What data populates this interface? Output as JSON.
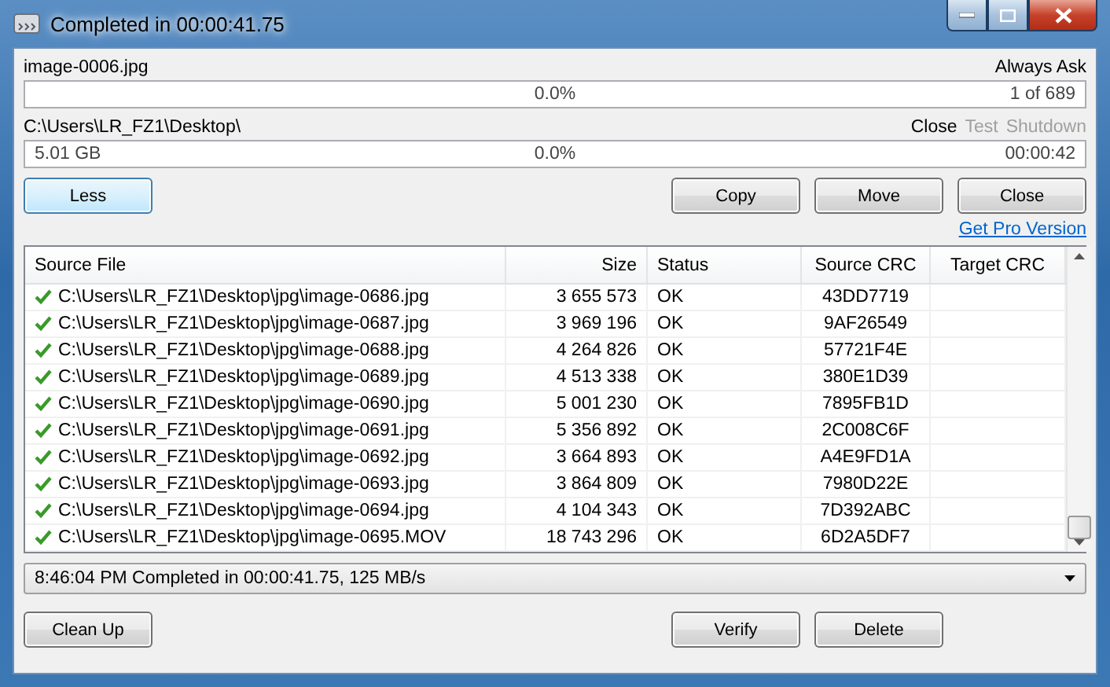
{
  "window": {
    "title": "Completed in 00:00:41.75"
  },
  "file_progress": {
    "name": "image-0006.jpg",
    "mode": "Always Ask",
    "level": 0,
    "percent": "0.0%",
    "count": "1 of 689"
  },
  "total_progress": {
    "path": "C:\\Users\\LR_FZ1\\Desktop\\",
    "size": "5.01 GB",
    "level": 0,
    "percent": "0.0%",
    "time": "00:00:42"
  },
  "after_actions": [
    {
      "label": "Close",
      "disabled": false
    },
    {
      "label": "Test",
      "disabled": true
    },
    {
      "label": "Shutdown",
      "disabled": true
    }
  ],
  "top_buttons": {
    "left": {
      "label": "Less",
      "focused": true
    },
    "right": [
      {
        "label": "Copy"
      },
      {
        "label": "Move"
      },
      {
        "label": "Close"
      }
    ]
  },
  "pro_link": "Get Pro Version",
  "table": {
    "columns": [
      "Source File",
      "Size",
      "Status",
      "Source CRC",
      "Target CRC"
    ],
    "rows": [
      {
        "file": "C:\\Users\\LR_FZ1\\Desktop\\jpg\\image-0686.jpg",
        "size": "3 655 573",
        "status": "OK",
        "source_crc": "43DD7719",
        "ok": true
      },
      {
        "file": "C:\\Users\\LR_FZ1\\Desktop\\jpg\\image-0687.jpg",
        "size": "3 969 196",
        "status": "OK",
        "source_crc": "9AF26549",
        "ok": true
      },
      {
        "file": "C:\\Users\\LR_FZ1\\Desktop\\jpg\\image-0688.jpg",
        "size": "4 264 826",
        "status": "OK",
        "source_crc": "57721F4E",
        "ok": true
      },
      {
        "file": "C:\\Users\\LR_FZ1\\Desktop\\jpg\\image-0689.jpg",
        "size": "4 513 338",
        "status": "OK",
        "source_crc": "380E1D39",
        "ok": true
      },
      {
        "file": "C:\\Users\\LR_FZ1\\Desktop\\jpg\\image-0690.jpg",
        "size": "5 001 230",
        "status": "OK",
        "source_crc": "7895FB1D",
        "ok": true
      },
      {
        "file": "C:\\Users\\LR_FZ1\\Desktop\\jpg\\image-0691.jpg",
        "size": "5 356 892",
        "status": "OK",
        "source_crc": "2C008C6F",
        "ok": true
      },
      {
        "file": "C:\\Users\\LR_FZ1\\Desktop\\jpg\\image-0692.jpg",
        "size": "3 664 893",
        "status": "OK",
        "source_crc": "A4E9FD1A",
        "ok": true
      },
      {
        "file": "C:\\Users\\LR_FZ1\\Desktop\\jpg\\image-0693.jpg",
        "size": "3 864 809",
        "status": "OK",
        "source_crc": "7980D22E",
        "ok": true
      },
      {
        "file": "C:\\Users\\LR_FZ1\\Desktop\\jpg\\image-0694.jpg",
        "size": "4 104 343",
        "status": "OK",
        "source_crc": "7D392ABC",
        "ok": true
      },
      {
        "file": "C:\\Users\\LR_FZ1\\Desktop\\jpg\\image-0695.MOV",
        "size": "18 743 296",
        "status": "OK",
        "source_crc": "6D2A5DF7",
        "ok": true
      }
    ]
  },
  "log": {
    "value": "8:46:04 PM Completed in 00:00:41.75, 125 MB/s"
  },
  "bottom_buttons": {
    "left": [
      {
        "label": "Clean Up"
      }
    ],
    "right": [
      {
        "label": "Verify"
      },
      {
        "label": "Delete"
      }
    ]
  }
}
